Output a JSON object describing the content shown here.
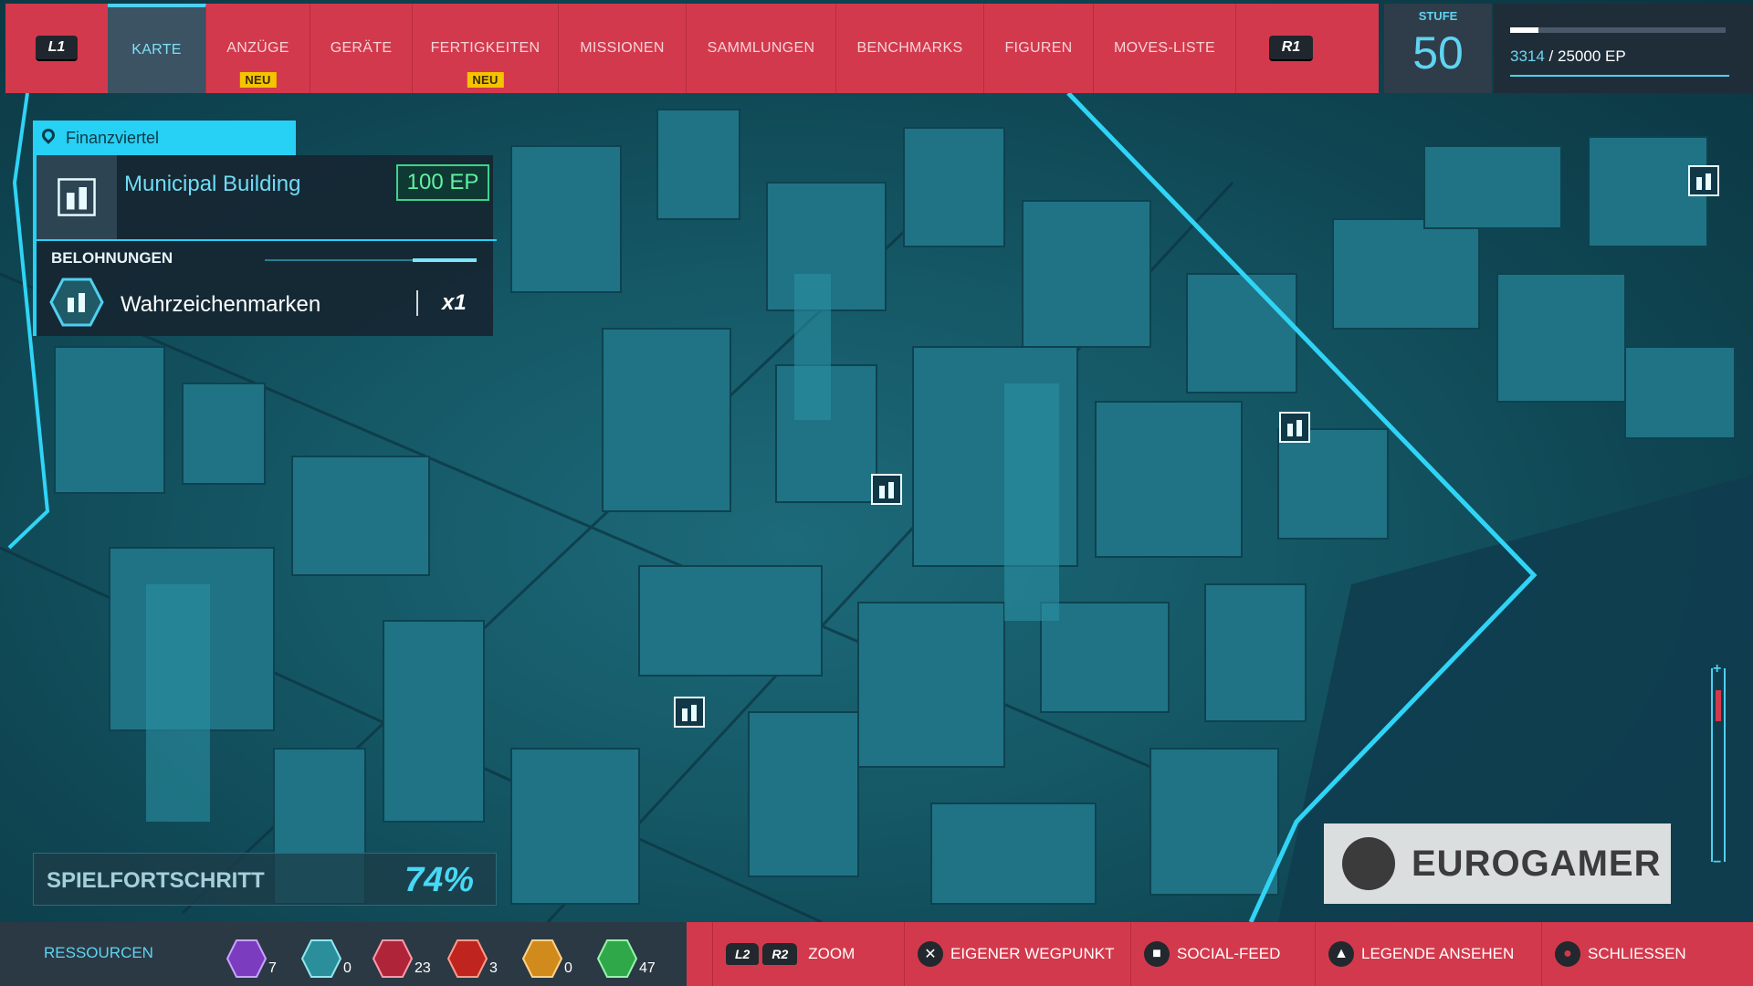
{
  "top_nav": {
    "left_button": "L1",
    "right_button": "R1",
    "tabs": [
      {
        "label": "KARTE",
        "active": true
      },
      {
        "label": "ANZÜGE",
        "badge": "NEU"
      },
      {
        "label": "GERÄTE"
      },
      {
        "label": "FERTIGKEITEN",
        "badge": "NEU"
      },
      {
        "label": "MISSIONEN"
      },
      {
        "label": "SAMMLUNGEN"
      },
      {
        "label": "BENCHMARKS"
      },
      {
        "label": "FIGUREN"
      },
      {
        "label": "MOVES-LISTE"
      }
    ]
  },
  "level": {
    "label": "STUFE",
    "value": "50"
  },
  "xp": {
    "current": "3314",
    "separator": " / ",
    "max": "25000 EP",
    "fraction": 0.13
  },
  "location": {
    "district": "Finanzviertel",
    "name": "Municipal Building",
    "xp_reward": "100 EP",
    "rewards_label": "BELOHNUNGEN",
    "reward_name": "Wahrzeichenmarken",
    "reward_qty": "x1",
    "icon": "landmark-icon"
  },
  "progress": {
    "label": "SPIELFORTSCHRITT",
    "value": "74%"
  },
  "watermark": {
    "text": "EUROGAMER"
  },
  "resources": {
    "label": "RESSOURCEN",
    "items": [
      {
        "icon": "research-token-icon",
        "count": "7",
        "color": "#7c3cc0"
      },
      {
        "icon": "landmark-token-icon",
        "count": "0",
        "color": "#2a8f9a"
      },
      {
        "icon": "backpack-token-icon",
        "count": "23",
        "color": "#b0243a"
      },
      {
        "icon": "crime-token-icon",
        "count": "3",
        "color": "#c0241f"
      },
      {
        "icon": "base-token-icon",
        "count": "0",
        "color": "#d18a1c"
      },
      {
        "icon": "challenge-token-icon",
        "count": "47",
        "color": "#2fa84a"
      }
    ]
  },
  "hints": [
    {
      "buttons": [
        "L2",
        "R2"
      ],
      "label": "ZOOM"
    },
    {
      "glyph": "cross-button-icon",
      "symbol": "✕",
      "label": "EIGENER WEGPUNKT"
    },
    {
      "glyph": "square-button-icon",
      "symbol": "■",
      "label": "SOCIAL-FEED"
    },
    {
      "glyph": "triangle-button-icon",
      "symbol": "▲",
      "label": "LEGENDE ANSEHEN"
    },
    {
      "glyph": "circle-button-icon",
      "symbol": "●",
      "label": "SCHLIESSEN"
    }
  ],
  "colors": {
    "accent_red": "#d3394c",
    "accent_cyan": "#27d0f5",
    "xp_green": "#5ff2a2",
    "neu_badge": "#f5c400"
  }
}
